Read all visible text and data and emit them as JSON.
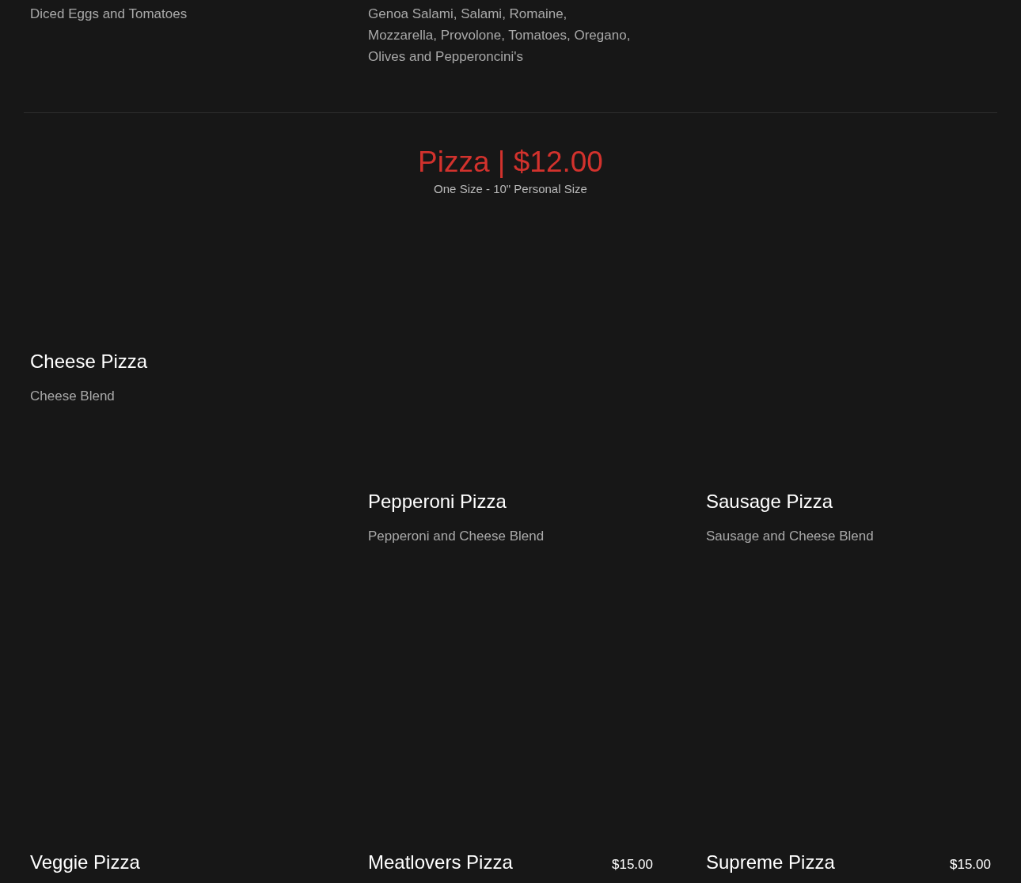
{
  "previous_items": [
    {
      "description": "Diced Eggs and Tomatoes"
    },
    {
      "description_lines": [
        "Genoa Salami, Salami, Romaine,",
        "Mozzarella, Provolone, Tomatoes, Oregano,",
        "Olives and Pepperoncini's"
      ]
    }
  ],
  "section": {
    "title": "Pizza | $12.00",
    "subtitle": "One Size - 10\" Personal Size"
  },
  "items": [
    {
      "name": "Cheese Pizza",
      "description": "Cheese Blend"
    },
    {
      "name": "Pepperoni Pizza",
      "description": "Pepperoni and Cheese Blend"
    },
    {
      "name": "Sausage Pizza",
      "description": "Sausage and Cheese Blend"
    },
    {
      "name": "Veggie Pizza"
    },
    {
      "name": "Meatlovers Pizza",
      "price": "$15.00"
    },
    {
      "name": "Supreme Pizza",
      "price": "$15.00"
    }
  ]
}
